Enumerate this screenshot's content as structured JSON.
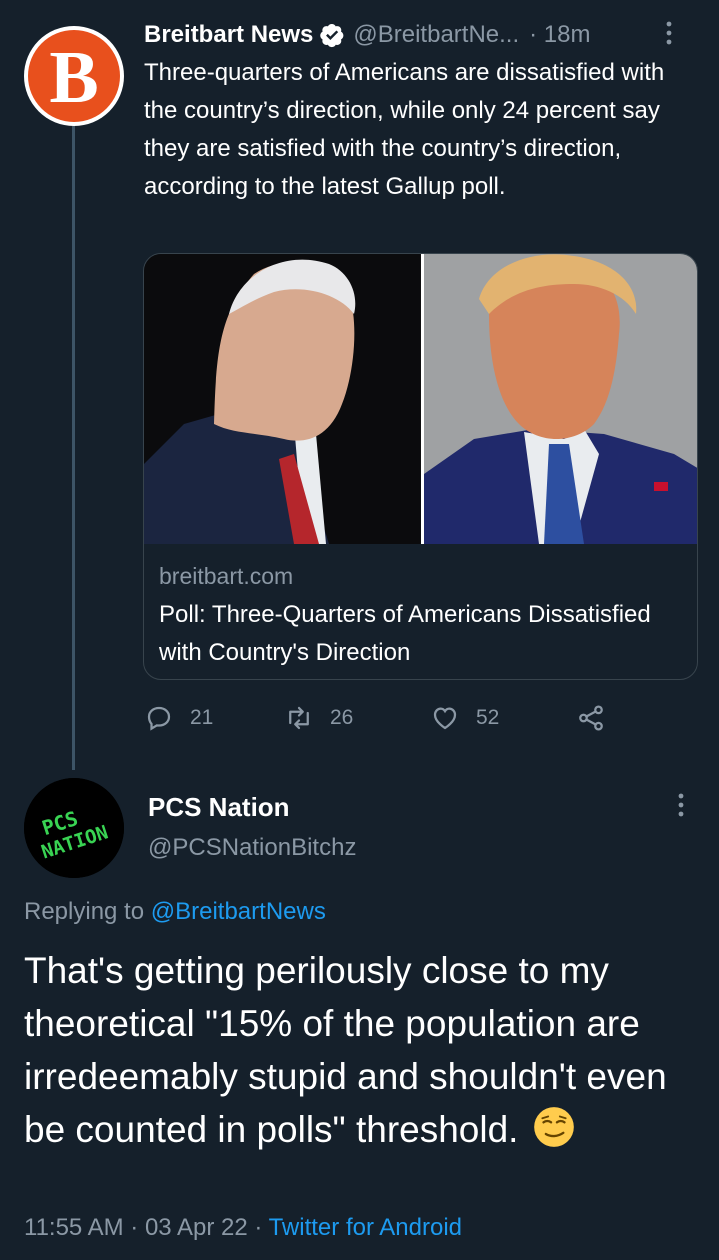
{
  "tweet": {
    "author_name": "Breitbart News",
    "author_handle": "@BreitbartNe...",
    "time": "· 18m",
    "avatar_letter": "B",
    "text": "Three-quarters of Americans are dissatisfied with the country’s direction, while only 24 percent say they are satisfied with the country’s direction, according to the latest Gallup poll.",
    "card": {
      "domain": "breitbart.com",
      "title": "Poll: Three-Quarters of Americans Dissatisfied with Country's Direction"
    },
    "actions": {
      "replies": "21",
      "retweets": "26",
      "likes": "52"
    }
  },
  "reply": {
    "author_name": "PCS Nation",
    "author_handle": "@PCSNationBitchz",
    "avatar_text": [
      "PCS",
      "NATION"
    ],
    "replying_prefix": "Replying to ",
    "replying_mention": "@BreitbartNews",
    "text": "That's getting perilously close to my theoretical \"15% of the population are irredeemably stupid and shouldn't even be counted in polls\" threshold.",
    "timestamp": "11:55 AM · 03 Apr 22 · ",
    "client": "Twitter for Android"
  },
  "icons": {
    "verified": "verified-badge-icon",
    "more": "more-options-icon",
    "reply": "reply-icon",
    "retweet": "retweet-icon",
    "like": "heart-icon",
    "share": "share-icon",
    "emoji": "smirking-face-emoji"
  },
  "colors": {
    "background": "#15202b",
    "secondary_text": "#8b98a5",
    "link": "#1d9bf0",
    "breitbart_orange": "#e8501d",
    "pcs_green": "#39d353"
  }
}
